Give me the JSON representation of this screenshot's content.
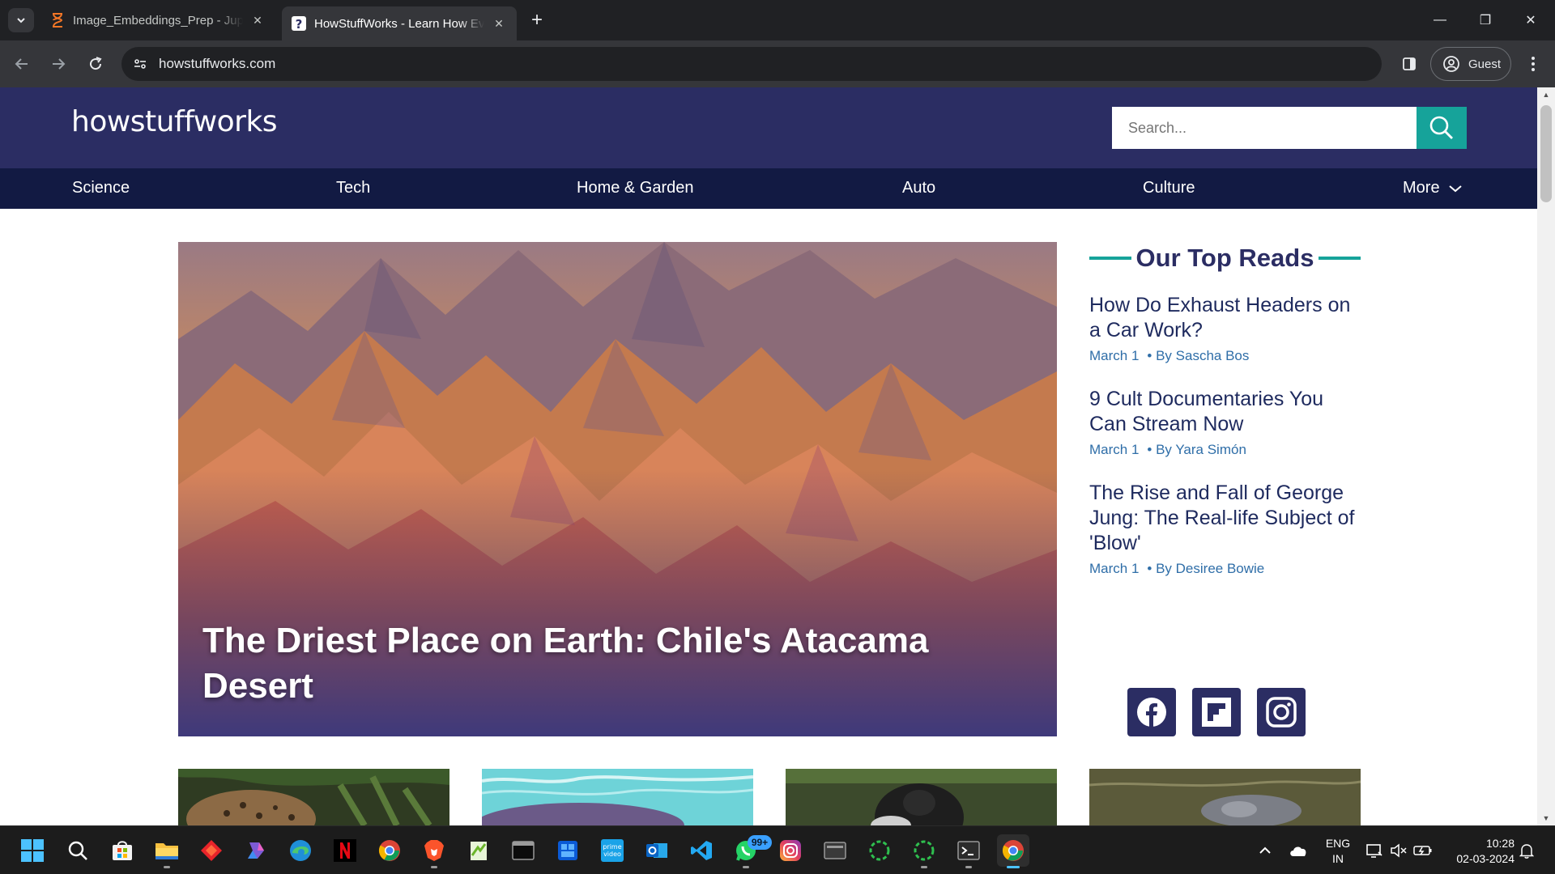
{
  "browser": {
    "tabs": [
      {
        "title": "Image_Embeddings_Prep - Jupyter",
        "icon": "hourglass-icon",
        "active": false
      },
      {
        "title": "HowStuffWorks - Learn How Everything Works",
        "icon": "howstuffworks-favicon",
        "active": true
      }
    ],
    "url": "howstuffworks.com",
    "profile_label": "Guest",
    "window_controls": {
      "minimize": "—",
      "restore": "❐",
      "close": "✕"
    }
  },
  "site": {
    "logo_text": "howstuffworks",
    "search_placeholder": "Search...",
    "nav": [
      "Science",
      "Tech",
      "Home & Garden",
      "Auto",
      "Culture",
      "More"
    ],
    "hero": {
      "title": "The Driest Place on Earth: Chile's Atacama Desert"
    },
    "top_reads": {
      "heading": "Our Top Reads",
      "items": [
        {
          "title": "How Do Exhaust Headers on a Car Work?",
          "date": "March 1",
          "author": "• By Sascha Bos"
        },
        {
          "title": "9 Cult Documentaries You Can Stream Now",
          "date": "March 1",
          "author": "• By Yara Simón"
        },
        {
          "title": "The Rise and Fall of George Jung: The Real-life Subject of 'Blow'",
          "date": "March 1",
          "author": "• By Desiree Bowie"
        }
      ]
    },
    "social": [
      "facebook-icon",
      "flipboard-icon",
      "instagram-icon"
    ],
    "cards": [
      "leopard-photo",
      "ocean-photo",
      "gorilla-photo",
      "dolphin-photo"
    ]
  },
  "taskbar": {
    "apps": [
      "start",
      "search",
      "store",
      "file-explorer",
      "app-red",
      "copilot",
      "edge",
      "netflix",
      "chrome",
      "brave",
      "notepad-plus",
      "terminal-window",
      "windows-app",
      "prime-video",
      "outlook",
      "vscode",
      "whatsapp",
      "instagram",
      "virtualbox",
      "loader-1",
      "loader-2",
      "cmd",
      "chrome-active"
    ],
    "whatsapp_badge": "99+",
    "lang_top": "ENG",
    "lang_bottom": "IN",
    "time": "10:28",
    "date": "02-03-2024"
  },
  "colors": {
    "header": "#2b2d63",
    "nav": "#121a43",
    "accent": "#16a39a",
    "link_meta": "#2f6ea8"
  }
}
